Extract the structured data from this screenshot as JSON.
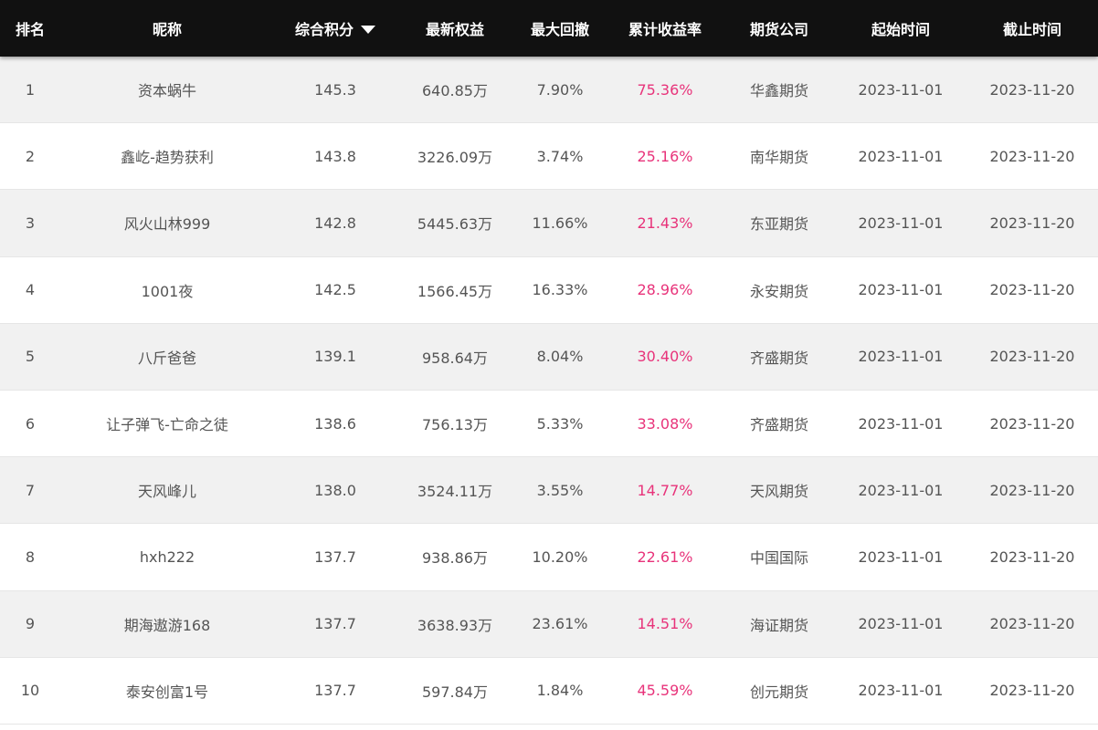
{
  "table": {
    "headers": {
      "rank": "排名",
      "name": "昵称",
      "score": "综合积分",
      "equity": "最新权益",
      "drawdown": "最大回撤",
      "return": "累计收益率",
      "company": "期货公司",
      "start": "起始时间",
      "end": "截止时间"
    },
    "sort_icon": "caret-down-icon",
    "return_color": "#e8337a",
    "rows": [
      {
        "rank": "1",
        "name": "资本蜗牛",
        "score": "145.3",
        "equity": "640.85万",
        "drawdown": "7.90%",
        "return": "75.36%",
        "company": "华鑫期货",
        "start": "2023-11-01",
        "end": "2023-11-20"
      },
      {
        "rank": "2",
        "name": "鑫屹-趋势获利",
        "score": "143.8",
        "equity": "3226.09万",
        "drawdown": "3.74%",
        "return": "25.16%",
        "company": "南华期货",
        "start": "2023-11-01",
        "end": "2023-11-20"
      },
      {
        "rank": "3",
        "name": "风火山林999",
        "score": "142.8",
        "equity": "5445.63万",
        "drawdown": "11.66%",
        "return": "21.43%",
        "company": "东亚期货",
        "start": "2023-11-01",
        "end": "2023-11-20"
      },
      {
        "rank": "4",
        "name": "1001夜",
        "score": "142.5",
        "equity": "1566.45万",
        "drawdown": "16.33%",
        "return": "28.96%",
        "company": "永安期货",
        "start": "2023-11-01",
        "end": "2023-11-20"
      },
      {
        "rank": "5",
        "name": "八斤爸爸",
        "score": "139.1",
        "equity": "958.64万",
        "drawdown": "8.04%",
        "return": "30.40%",
        "company": "齐盛期货",
        "start": "2023-11-01",
        "end": "2023-11-20"
      },
      {
        "rank": "6",
        "name": "让子弹飞-亡命之徒",
        "score": "138.6",
        "equity": "756.13万",
        "drawdown": "5.33%",
        "return": "33.08%",
        "company": "齐盛期货",
        "start": "2023-11-01",
        "end": "2023-11-20"
      },
      {
        "rank": "7",
        "name": "天风峰儿",
        "score": "138.0",
        "equity": "3524.11万",
        "drawdown": "3.55%",
        "return": "14.77%",
        "company": "天风期货",
        "start": "2023-11-01",
        "end": "2023-11-20"
      },
      {
        "rank": "8",
        "name": "hxh222",
        "score": "137.7",
        "equity": "938.86万",
        "drawdown": "10.20%",
        "return": "22.61%",
        "company": "中国国际",
        "start": "2023-11-01",
        "end": "2023-11-20"
      },
      {
        "rank": "9",
        "name": "期海遨游168",
        "score": "137.7",
        "equity": "3638.93万",
        "drawdown": "23.61%",
        "return": "14.51%",
        "company": "海证期货",
        "start": "2023-11-01",
        "end": "2023-11-20"
      },
      {
        "rank": "10",
        "name": "泰安创富1号",
        "score": "137.7",
        "equity": "597.84万",
        "drawdown": "1.84%",
        "return": "45.59%",
        "company": "创元期货",
        "start": "2023-11-01",
        "end": "2023-11-20"
      }
    ]
  }
}
